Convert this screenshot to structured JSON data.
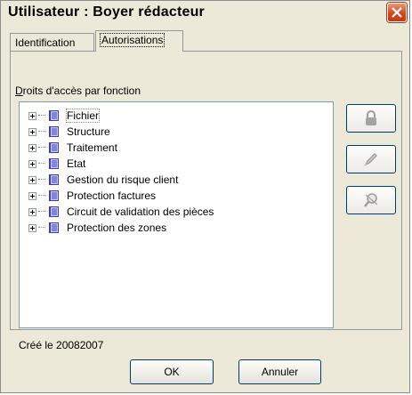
{
  "window": {
    "title": "Utilisateur : Boyer rédacteur",
    "close_icon": "close-icon"
  },
  "tabs": [
    {
      "label": "Identification",
      "active": false
    },
    {
      "label": "Autorisations",
      "active": true
    }
  ],
  "panel": {
    "group_label_underlined": "D",
    "group_label_rest": "roits d'accès par fonction",
    "tree_items": [
      {
        "label": "Fichier",
        "icon": "book-icon"
      },
      {
        "label": "Structure",
        "icon": "book-icon"
      },
      {
        "label": "Traitement",
        "icon": "book-icon"
      },
      {
        "label": "Etat",
        "icon": "book-icon"
      },
      {
        "label": "Gestion du risque client",
        "icon": "book-icon"
      },
      {
        "label": "Protection factures",
        "icon": "book-icon"
      },
      {
        "label": "Circuit de validation des pièces",
        "icon": "book-icon"
      },
      {
        "label": "Protection des zones",
        "icon": "book-icon"
      }
    ],
    "side_buttons": [
      {
        "icon": "lock-icon"
      },
      {
        "icon": "edit-pencil-icon"
      },
      {
        "icon": "search-denied-icon"
      }
    ]
  },
  "footer": {
    "created_text": "Créé le 20082007",
    "ok_label": "OK",
    "cancel_label": "Annuler"
  },
  "colors": {
    "title_bar": "#ece9d8",
    "close_button": "#cf4a22",
    "tree_book": "#3d3fb1"
  }
}
